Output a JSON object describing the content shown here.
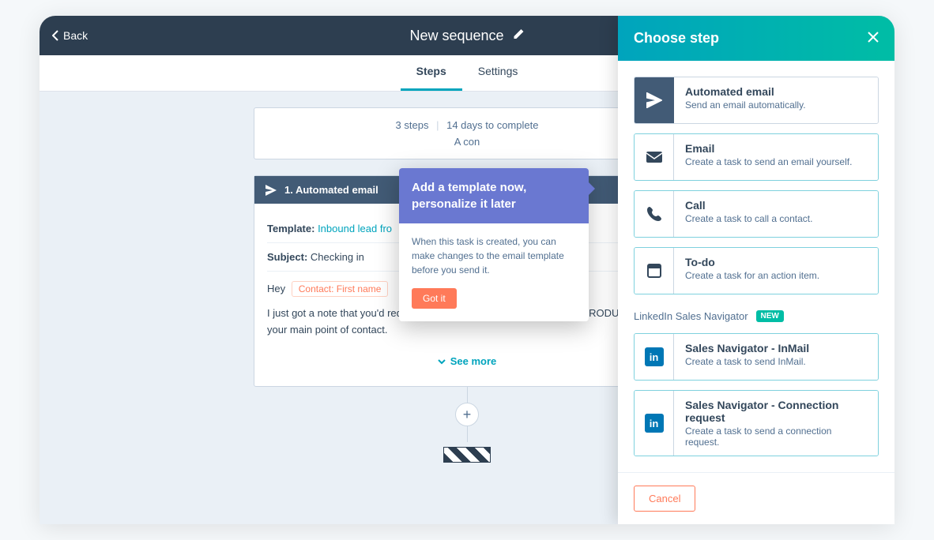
{
  "header": {
    "back": "Back",
    "title": "New sequence"
  },
  "tabs": {
    "steps": "Steps",
    "settings": "Settings"
  },
  "summary": {
    "steps_count": "3 steps",
    "days": "14 days to complete",
    "subtitle": "A con"
  },
  "step1": {
    "title": "1. Automated email",
    "template_label": "Template:",
    "template_value": "Inbound lead fro",
    "subject_label": "Subject:",
    "subject_value": "Checking in",
    "greeting": "Hey",
    "token": "Contact: First name",
    "body": "I just got a note that you'd requested some more information about X PRODUCT as your main point of contact.",
    "see_more": "See more"
  },
  "popover": {
    "title": "Add a template now, personalize it later",
    "body": "When this task is created, you can make changes to the email template before you send it.",
    "button": "Got it"
  },
  "panel": {
    "title": "Choose step",
    "options": [
      {
        "title": "Automated email",
        "desc": "Send an email automatically."
      },
      {
        "title": "Email",
        "desc": "Create a task to send an email yourself."
      },
      {
        "title": "Call",
        "desc": "Create a task to call a contact."
      },
      {
        "title": "To-do",
        "desc": "Create a task for an action item."
      }
    ],
    "linkedin_label": "LinkedIn Sales Navigator",
    "new_badge": "NEW",
    "linkedin_options": [
      {
        "title": "Sales Navigator - InMail",
        "desc": "Create a task to send InMail."
      },
      {
        "title": "Sales Navigator - Connection request",
        "desc": "Create a task to send a connection request."
      }
    ],
    "cancel": "Cancel"
  }
}
